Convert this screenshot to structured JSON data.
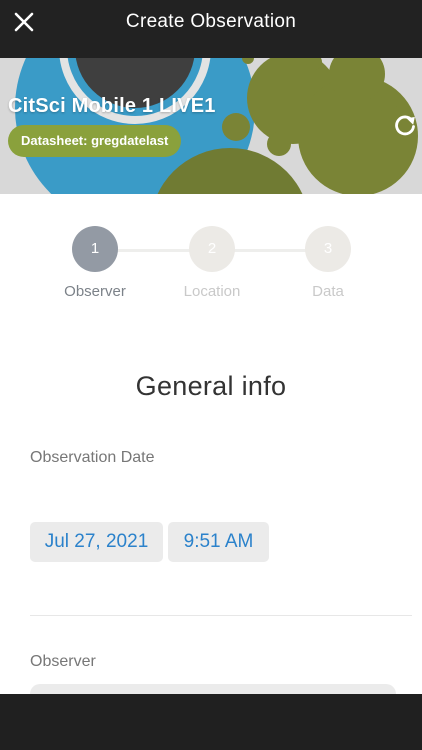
{
  "header": {
    "title": "Create Observation",
    "close_icon": "close-icon",
    "background_color": "#222222"
  },
  "banner": {
    "project_title": "CitSci Mobile 1 LIVE1",
    "datasheet_label": "Datasheet: gregdatelast",
    "refresh_icon": "refresh-icon",
    "badge_color": "#8aa13c"
  },
  "stepper": {
    "steps": [
      {
        "number": "1",
        "label": "Observer",
        "active": true
      },
      {
        "number": "2",
        "label": "Location",
        "active": false
      },
      {
        "number": "3",
        "label": "Data",
        "active": false
      }
    ]
  },
  "form": {
    "section_title": "General info",
    "date_label": "Observation Date",
    "date_value": "Jul 27, 2021",
    "time_value": "9:51 AM",
    "observer_label": "Observer",
    "link_color": "#2b82cb"
  }
}
